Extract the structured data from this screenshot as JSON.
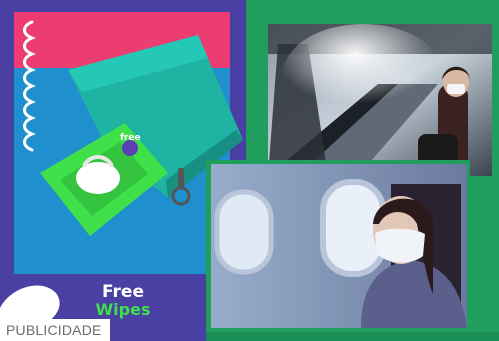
{
  "ad": {
    "label": "PUBLICIDADE",
    "brand": {
      "line1": "Free",
      "line2": "Wipes"
    },
    "colors": {
      "purple": "#4a3fa3",
      "pink": "#ec3d72",
      "blue": "#1f8fce",
      "green_frame": "#1f9e5d",
      "product_green": "#3fe04a"
    },
    "images": [
      {
        "name": "product-photo",
        "subject": "teal pouch with green wipes pack"
      },
      {
        "name": "escalator-photo",
        "subject": "woman wearing face mask on escalator"
      },
      {
        "name": "plane-photo",
        "subject": "woman wearing face mask by airplane window"
      }
    ]
  }
}
